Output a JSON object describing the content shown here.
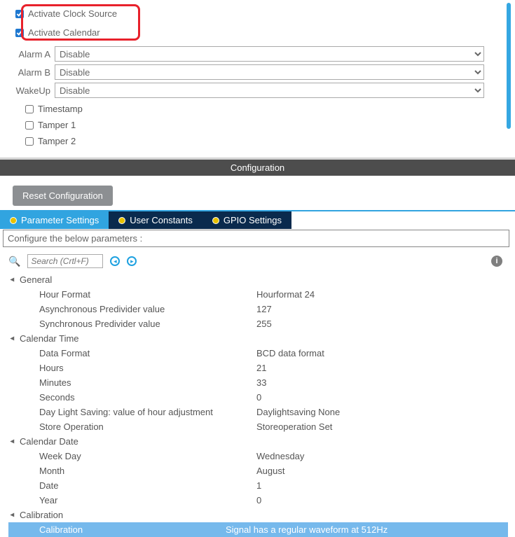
{
  "top": {
    "activate_clock": "Activate Clock Source",
    "activate_cal": "Activate Calendar",
    "alarm_a_label": "Alarm A",
    "alarm_b_label": "Alarm B",
    "wakeup_label": "WakeUp",
    "disable": "Disable",
    "timestamp": "Timestamp",
    "tamper1": "Tamper 1",
    "tamper2": "Tamper 2"
  },
  "config": {
    "bar": "Configuration",
    "reset": "Reset Configuration",
    "tab_param": "Parameter Settings",
    "tab_user": "User Constants",
    "tab_gpio": "GPIO Settings",
    "desc": "Configure the below parameters :",
    "search_ph": "Search (Crtl+F)"
  },
  "groups": {
    "general": "General",
    "caltime": "Calendar Time",
    "caldate": "Calendar Date",
    "calib": "Calibration"
  },
  "params": {
    "hour_format": {
      "label": "Hour Format",
      "value": "Hourformat 24"
    },
    "async_pd": {
      "label": "Asynchronous Predivider value",
      "value": "127"
    },
    "sync_pd": {
      "label": "Synchronous Predivider value",
      "value": "255"
    },
    "data_format": {
      "label": "Data Format",
      "value": "BCD data format"
    },
    "hours": {
      "label": "Hours",
      "value": "21"
    },
    "minutes": {
      "label": "Minutes",
      "value": "33"
    },
    "seconds": {
      "label": "Seconds",
      "value": "0"
    },
    "dls": {
      "label": "Day Light Saving: value of hour adjustment",
      "value": "Daylightsaving None"
    },
    "store_op": {
      "label": "Store Operation",
      "value": "Storeoperation Set"
    },
    "weekday": {
      "label": "Week Day",
      "value": "Wednesday"
    },
    "month": {
      "label": "Month",
      "value": "August"
    },
    "date": {
      "label": "Date",
      "value": "1"
    },
    "year": {
      "label": "Year",
      "value": "0"
    },
    "calibration": {
      "label": "Calibration",
      "value": "Signal has a regular waveform at 512Hz"
    }
  }
}
